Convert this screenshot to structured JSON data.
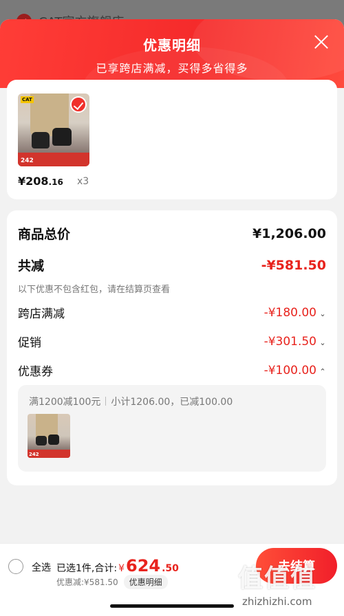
{
  "background": {
    "store_name": "CAT官方旗舰店 ›"
  },
  "header": {
    "title": "优惠明细",
    "subtitle": "已享跨店满减，买得多省得多"
  },
  "product": {
    "price_int": "¥208",
    "price_dec": ".16",
    "quantity": "x3",
    "thumb_tag": "242",
    "brand": "CAT"
  },
  "summary": {
    "total_label": "商品总价",
    "total_value": "¥1,206.00",
    "reduce_label": "共减",
    "reduce_value": "-¥581.50",
    "note": "以下优惠不包含红包，请在结算页查看",
    "items": [
      {
        "label": "跨店满减",
        "value": "-¥180.00",
        "caret": "⌄"
      },
      {
        "label": "促销",
        "value": "-¥301.50",
        "caret": "⌄"
      },
      {
        "label": "优惠券",
        "value": "-¥100.00",
        "caret": "⌃"
      }
    ],
    "coupon_rule": "满1200减100元",
    "coupon_detail": "小计1206.00，已减100.00",
    "mini_tag": "242"
  },
  "bottom": {
    "select_all": "全选",
    "selected_info": "已选1件,合计:",
    "total_yen": "¥",
    "total_int": "624",
    "total_dec": ".50",
    "discount": "优惠减:¥581.50",
    "detail_button": "优惠明细",
    "checkout": "去结算"
  },
  "watermark": {
    "text": "值值值",
    "url": "zhizhizhi.com"
  },
  "colors": {
    "accent": "#e8231d",
    "header": "#f52b2b"
  }
}
